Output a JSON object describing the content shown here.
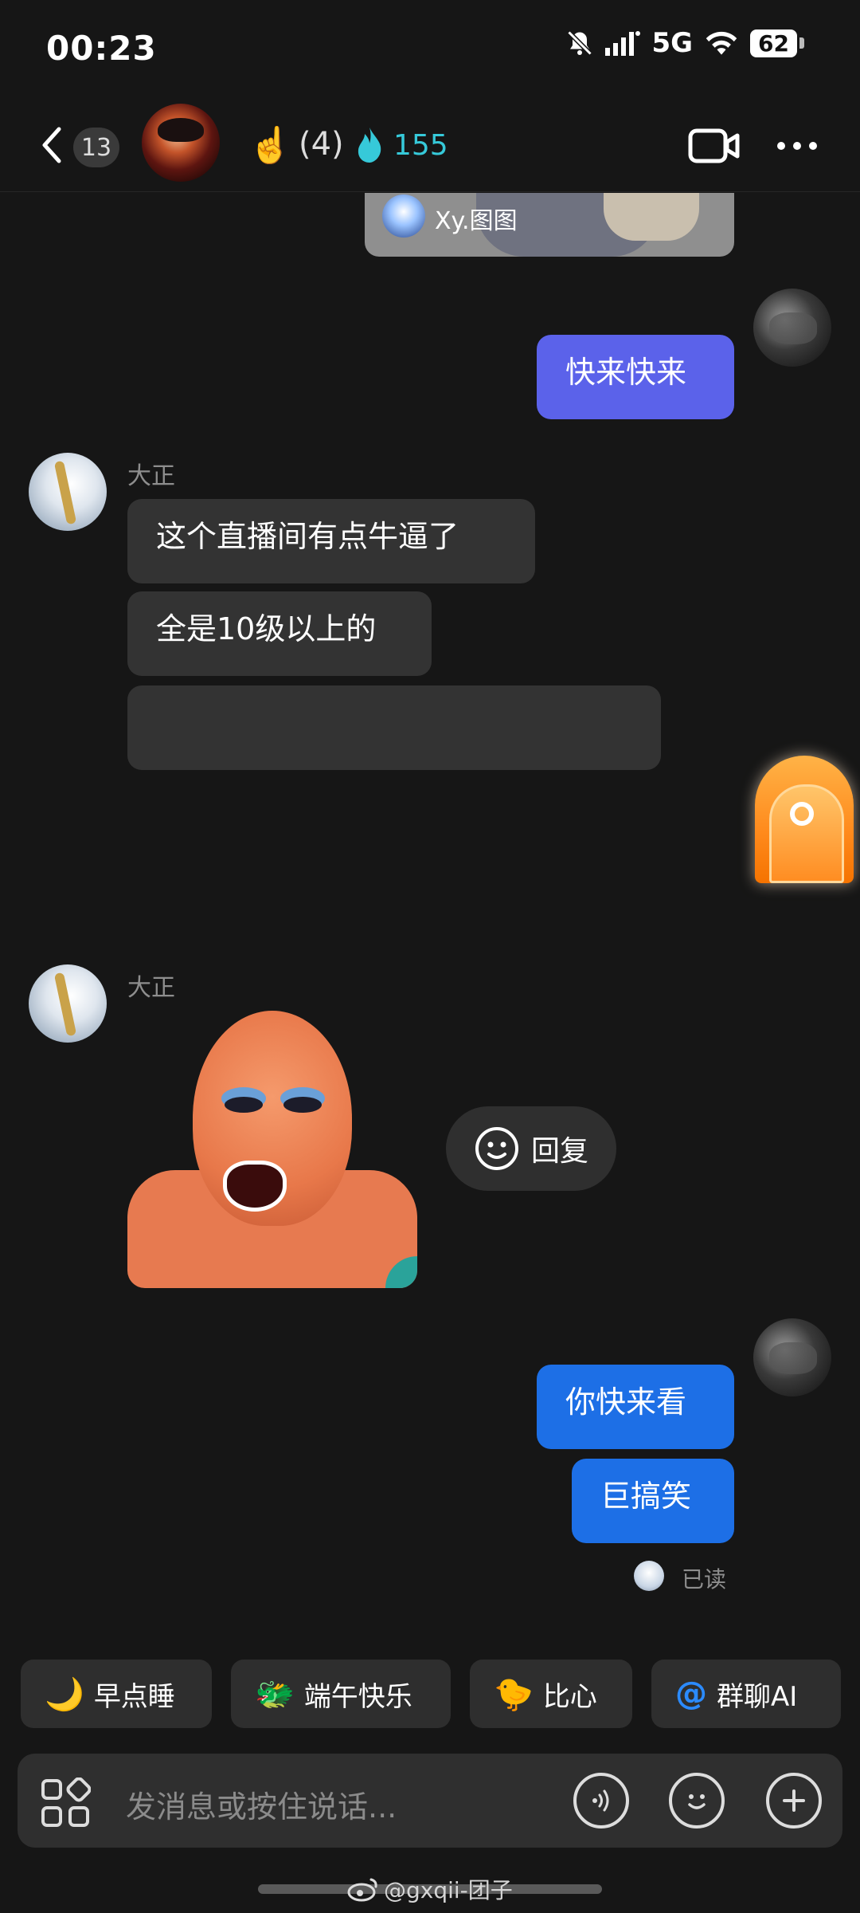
{
  "status_bar": {
    "time": "00:23",
    "network": "5G",
    "battery": "62",
    "icons": [
      "bell-muted-icon",
      "signal-icon",
      "wifi-icon",
      "battery-icon"
    ]
  },
  "header": {
    "back_count": "13",
    "member_count": "(4)",
    "flame_count": "155",
    "hand_emoji": "☝️"
  },
  "shared_card": {
    "name": "Xy.图图"
  },
  "messages": {
    "out1": "快来快来",
    "sender1": "大正",
    "in1": "这个直播间有点牛逼了",
    "in2": "全是10级以上的",
    "in3": "",
    "sender2": "大正",
    "reply_label": "回复",
    "out2": "你快来看",
    "out3": "巨搞笑",
    "read_label": "已读"
  },
  "quick_chips": [
    {
      "emoji": "🌙",
      "label": "早点睡"
    },
    {
      "emoji": "🐲",
      "label": "端午快乐"
    },
    {
      "emoji": "🐤",
      "label": "比心"
    },
    {
      "emoji": "@",
      "label": "群聊AI"
    }
  ],
  "input": {
    "placeholder": "发消息或按住说话..."
  },
  "watermark": "@gxqii-团子",
  "colors": {
    "background": "#161616",
    "bubble_in": "#333333",
    "bubble_out_purple": "#5b62ea",
    "bubble_out_blue": "#1d6fe6",
    "flame_accent": "#36c9d9"
  }
}
